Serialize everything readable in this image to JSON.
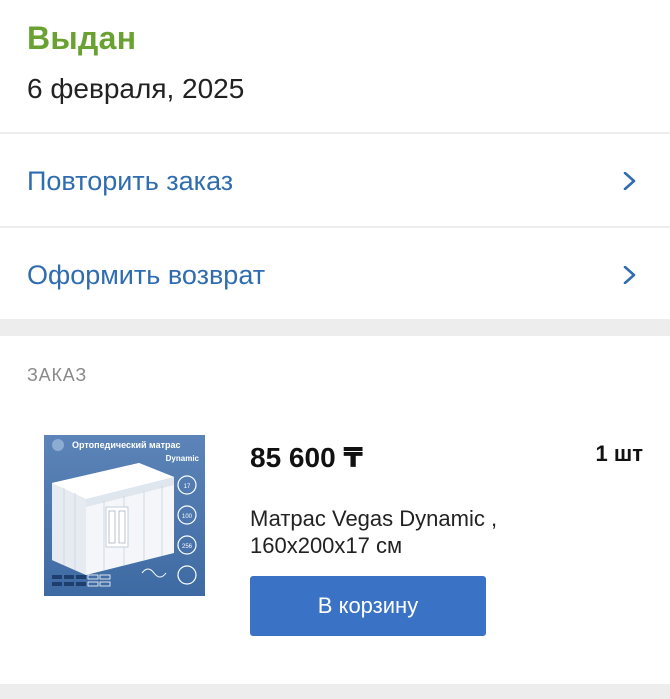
{
  "status": {
    "title": "Выдан",
    "date": "6 февраля, 2025",
    "title_color": "#6aa232"
  },
  "actions": [
    {
      "label": "Повторить заказ",
      "icon": "chevron-right-icon"
    },
    {
      "label": "Оформить возврат",
      "icon": "chevron-right-icon"
    }
  ],
  "order": {
    "section_label": "ЗАКАЗ",
    "item": {
      "price": "85 600 ₸",
      "quantity": "1 шт",
      "name": "Матрас Vegas Dynamic , 160x200x17 см",
      "image": {
        "title_line1": "Ортопедический матрас",
        "title_line2": "Dynamic",
        "badge_height": "17",
        "badge_load": "100",
        "badge_size": "256"
      },
      "button_label": "В корзину"
    }
  },
  "colors": {
    "link": "#2f6db0",
    "button": "#3a73c6",
    "band": "#ededed"
  }
}
